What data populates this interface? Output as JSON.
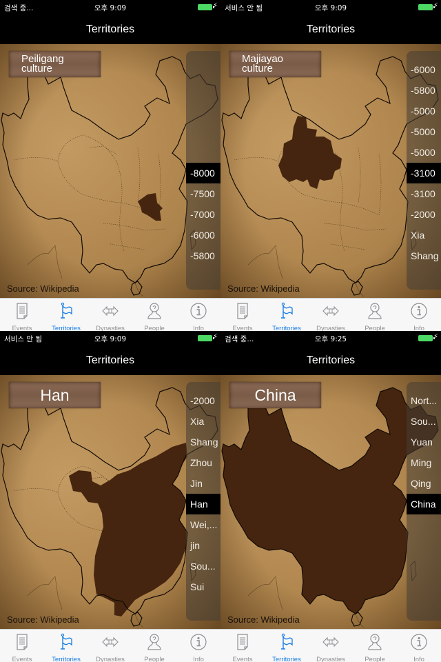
{
  "screens": [
    {
      "status": {
        "carrier": "검색 중...",
        "time": "오후 9:09"
      },
      "nav_title": "Territories",
      "label": "Peiligang\nculture",
      "label_lines": [
        "Peiligang",
        "culture"
      ],
      "source": "Source: Wikipedia",
      "picker": {
        "items": [
          "-8000",
          "-7500",
          "-7000",
          "-6000",
          "-5800"
        ],
        "selected": "-8000",
        "selected_index": 0,
        "first_row": 6
      },
      "territory": "peiligang"
    },
    {
      "status": {
        "carrier": "서비스 안 됨",
        "time": "오후 9:09"
      },
      "nav_title": "Territories",
      "label_lines": [
        "Majiayao",
        "culture"
      ],
      "source": "Source: Wikipedia",
      "picker": {
        "items": [
          "-6000",
          "-5800",
          "-5000",
          "-5000",
          "-5000",
          "-3100",
          "-3100",
          "-2000",
          "Xia",
          "Shang"
        ],
        "selected": "-3100",
        "selected_index": 5,
        "first_row": 1
      },
      "territory": "majiayao"
    },
    {
      "status": {
        "carrier": "서비스 안 됨",
        "time": "오후 9:09"
      },
      "nav_title": "Territories",
      "label_lines": [
        "Han"
      ],
      "source": "Source: Wikipedia",
      "picker": {
        "items": [
          "-2000",
          "Xia",
          "Shang",
          "Zhou",
          "Jin",
          "Han",
          "Wei,...",
          "jin",
          "Sou...",
          "Sui"
        ],
        "selected": "Han",
        "selected_index": 5,
        "first_row": 1
      },
      "territory": "han"
    },
    {
      "status": {
        "carrier": "검색 중...",
        "time": "오후 9:25"
      },
      "nav_title": "Territories",
      "label_lines": [
        "China"
      ],
      "source": "Source: Wikipedia",
      "picker": {
        "items": [
          "Nort...",
          "Sou...",
          "Yuan",
          "Ming",
          "Qing",
          "China"
        ],
        "selected": "China",
        "selected_index": 5,
        "first_row": 1
      },
      "territory": "china"
    }
  ],
  "tabs": [
    {
      "label": "Events",
      "icon": "document-icon"
    },
    {
      "label": "Territories",
      "icon": "flag-icon",
      "active": true
    },
    {
      "label": "Dynasties",
      "icon": "double-arrow-icon"
    },
    {
      "label": "People",
      "icon": "person-icon"
    },
    {
      "label": "Info",
      "icon": "info-icon"
    }
  ],
  "colors": {
    "accent": "#1a7ee6",
    "territory_fill": "#45250f",
    "battery": "#4cd964",
    "parchment": "#b48a52"
  }
}
